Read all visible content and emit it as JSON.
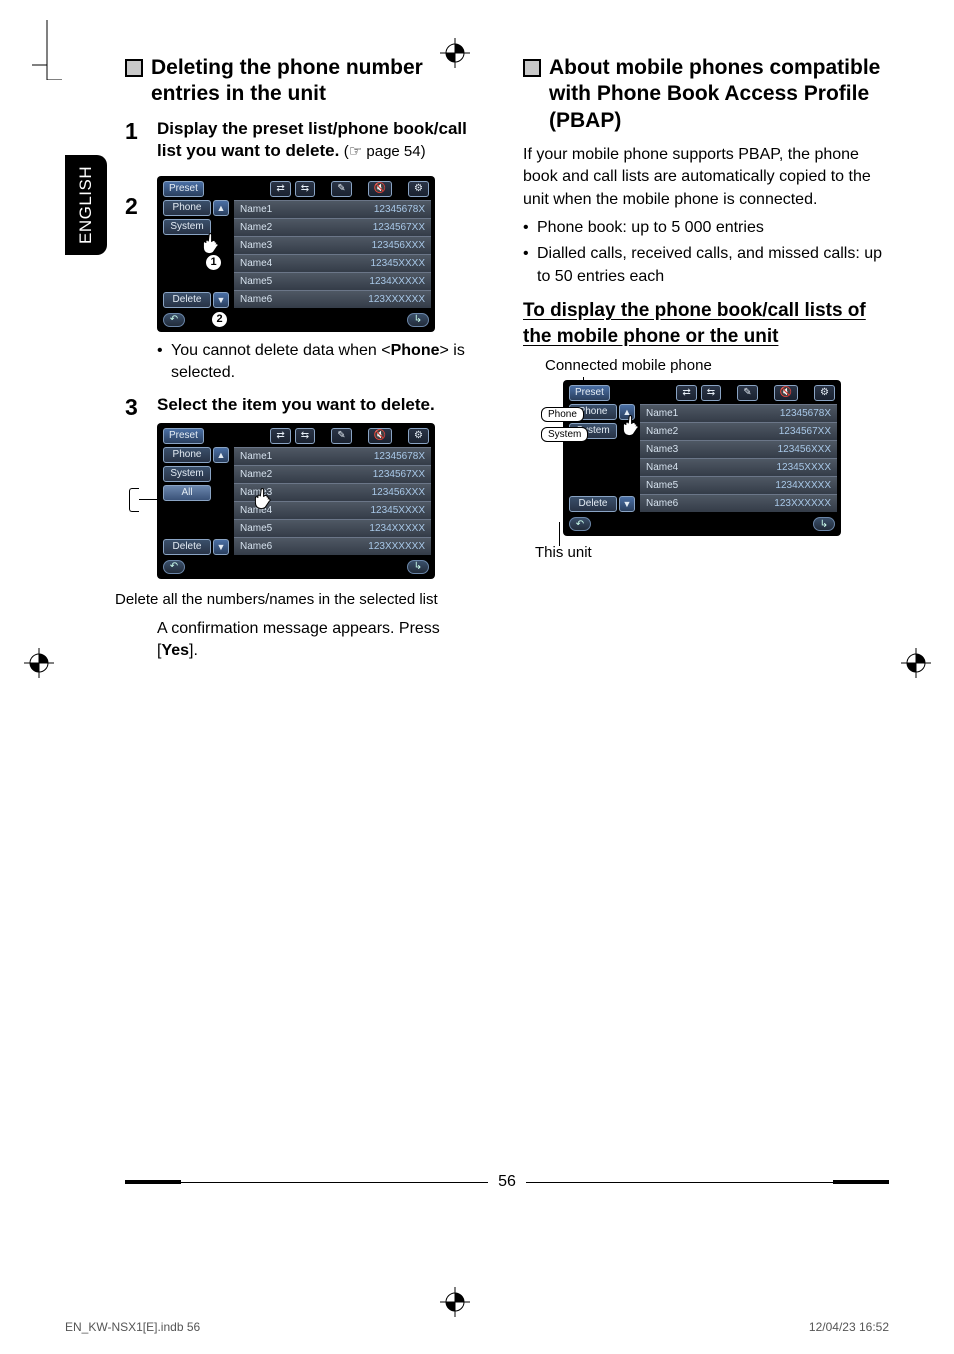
{
  "language_tab": "ENGLISH",
  "page_number": "56",
  "footer": {
    "left": "EN_KW-NSX1[E].indb   56",
    "right": "12/04/23   16:52"
  },
  "left": {
    "section_title": "Deleting the phone number entries in the unit",
    "step1": {
      "num": "1",
      "text_bold": "Display the preset list/phone book/call list you want to delete.",
      "text_light_prefix": " (",
      "pointer": "☞",
      "text_light_suffix": " page 54)"
    },
    "step2": {
      "num": "2"
    },
    "device_common": {
      "tabs": {
        "preset": "Preset",
        "phone": "Phone",
        "system": "System",
        "delete": "Delete",
        "all": "All"
      },
      "top_icons": [
        "⇄",
        "⇆",
        "✎",
        "🔇",
        "⚙"
      ],
      "rows": [
        {
          "name": "Name1",
          "val": "12345678X"
        },
        {
          "name": "Name2",
          "val": "1234567XX"
        },
        {
          "name": "Name3",
          "val": "123456XXX"
        },
        {
          "name": "Name4",
          "val": "12345XXXX"
        },
        {
          "name": "Name5",
          "val": "1234XXXXX"
        },
        {
          "name": "Name6",
          "val": "123XXXXXX"
        }
      ]
    },
    "step2_note": "You cannot delete data when <Phone> is selected.",
    "step2_note_pre": "You cannot delete data when <",
    "step2_note_bold": "Phone",
    "step2_note_post": "> is selected.",
    "step3": {
      "num": "3",
      "text": "Select the item you want to delete."
    },
    "delete_all_caption": "Delete all the numbers/names in the selected list",
    "confirm_pre": "A confirmation message appears. Press [",
    "confirm_bold": "Yes",
    "confirm_post": "].",
    "circ1": "1",
    "circ2": "2"
  },
  "right": {
    "section_title": "About mobile phones compatible with Phone Book Access Profile (PBAP)",
    "para1": "If your mobile phone supports PBAP, the phone book and call lists are automatically copied to the unit when the mobile phone is connected.",
    "bullets": [
      "Phone book: up to 5 000 entries",
      "Dialled calls, received calls, and missed calls: up to 50 entries each"
    ],
    "subheading": "To display the phone book/call lists of the mobile phone or the unit",
    "caption_top": "Connected mobile phone",
    "caption_bottom": "This unit",
    "callout_phone": "Phone",
    "callout_system": "System"
  }
}
